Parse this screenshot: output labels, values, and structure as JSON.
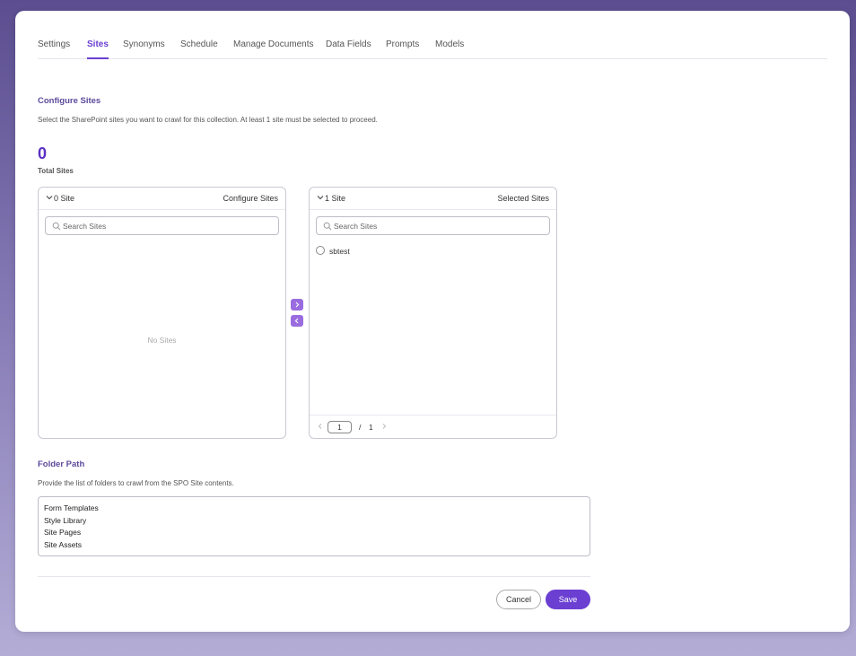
{
  "tabs": [
    {
      "label": "Settings",
      "active": false
    },
    {
      "label": "Sites",
      "active": true
    },
    {
      "label": "Synonyms",
      "active": false
    },
    {
      "label": "Schedule",
      "active": false
    },
    {
      "label": "Manage Documents",
      "active": false
    },
    {
      "label": "Data Fields",
      "active": false
    },
    {
      "label": "Prompts",
      "active": false
    },
    {
      "label": "Models",
      "active": false
    }
  ],
  "configure": {
    "title": "Configure Sites",
    "description": "Select the SharePoint sites you want to crawl for this collection. At least 1 site must be selected to proceed.",
    "total_value": "0",
    "total_label": "Total Sites"
  },
  "left_panel": {
    "count": "0 Site",
    "title": "Configure Sites",
    "search_placeholder": "Search Sites",
    "empty_text": "No Sites"
  },
  "right_panel": {
    "count": "1 Site",
    "title": "Selected Sites",
    "search_placeholder": "Search Sites",
    "items": [
      "sbtest"
    ],
    "page_current": "1",
    "page_sep": "/",
    "page_total": "1"
  },
  "folder": {
    "title": "Folder Path",
    "description": "Provide the list of folders to crawl from the SPO Site contents.",
    "lines": [
      "Form Templates",
      "Style Library",
      "Site Pages",
      "Site Assets"
    ]
  },
  "actions": {
    "cancel": "Cancel",
    "save": "Save"
  },
  "colors": {
    "accent": "#6a3fd1",
    "move_button": "#9a6ce0"
  }
}
